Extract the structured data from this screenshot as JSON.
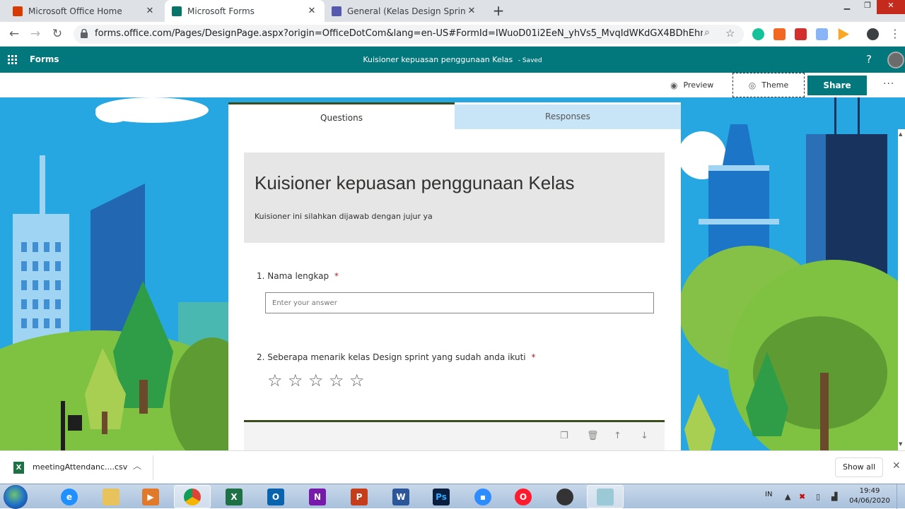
{
  "browser": {
    "tabs": [
      {
        "title": "Microsoft Office Home",
        "favicon_color": "#d83b01",
        "active": false
      },
      {
        "title": "Microsoft Forms",
        "favicon_color": "#077568",
        "active": true
      },
      {
        "title": "General (Kelas Design Sprint 1) | M",
        "favicon_color": "#5558af",
        "active": false
      }
    ],
    "url": "forms.office.com/Pages/DesignPage.aspx?origin=OfficeDotCom&lang=en-US#FormId=IWuoD01i2EeN_yhVs5_MvqIdWKdGX4BDhEhnL43gpI1U..."
  },
  "appbar": {
    "app_name": "Forms",
    "form_title": "Kuisioner kepuasan penggunaan Kelas",
    "status": "- Saved",
    "help": "?"
  },
  "commands": {
    "preview": "Preview",
    "theme": "Theme",
    "share": "Share"
  },
  "form": {
    "tabs": {
      "questions": "Questions",
      "responses": "Responses"
    },
    "title": "Kuisioner kepuasan penggunaan Kelas",
    "description": "Kuisioner ini silahkan dijawab dengan jujur ya",
    "questions": [
      {
        "number": "1.",
        "text": "Nama lengkap",
        "required": "*",
        "placeholder": "Enter your answer"
      },
      {
        "number": "2.",
        "text": "Seberapa menarik kelas Design sprint yang sudah anda ikuti",
        "required": "*",
        "rating_max": 5
      }
    ]
  },
  "download_shelf": {
    "file_name": "meetingAttendanc....csv",
    "show_all": "Show all"
  },
  "taskbar": {
    "language": "IN",
    "time": "19:49",
    "date": "04/06/2020"
  },
  "colors": {
    "forms_teal": "#03787c",
    "theme_dark_green": "#3b4d1f",
    "sky_blue": "#27a7e1",
    "responses_tab": "#c7e5f6"
  }
}
